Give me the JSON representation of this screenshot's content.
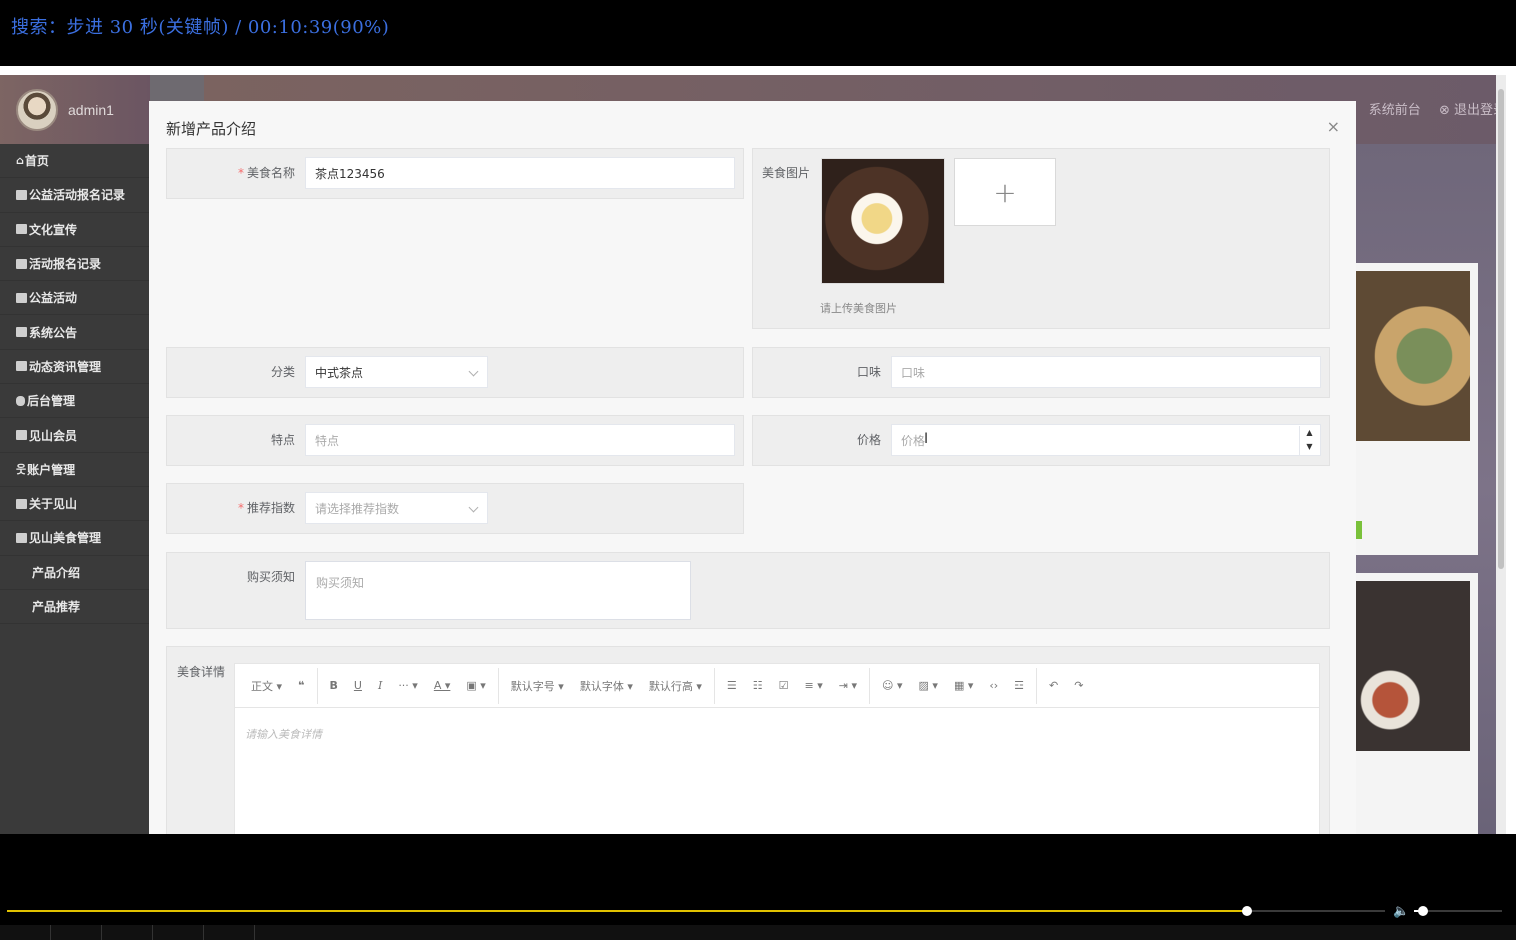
{
  "osd": {
    "text": "搜索：步进 30 秒(关键帧) / 00:10:39(90%)"
  },
  "sidebar": {
    "username": "admin1",
    "items": [
      {
        "label": "首页",
        "icon": "home-icon"
      },
      {
        "label": "公益活动报名记录",
        "icon": "grid-icon"
      },
      {
        "label": "文化宣传",
        "icon": "grid-icon"
      },
      {
        "label": "活动报名记录",
        "icon": "grid-icon"
      },
      {
        "label": "公益活动",
        "icon": "grid-icon"
      },
      {
        "label": "系统公告",
        "icon": "grid-icon"
      },
      {
        "label": "动态资讯管理",
        "icon": "grid-icon"
      },
      {
        "label": "后台管理",
        "icon": "grid-icon"
      },
      {
        "label": "见山会员",
        "icon": "grid-icon"
      },
      {
        "label": "账户管理",
        "icon": "user-icon"
      },
      {
        "label": "关于见山",
        "icon": "briefcase-icon"
      },
      {
        "label": "见山美食管理",
        "icon": "grid-icon"
      }
    ],
    "subitems": [
      "产品介绍",
      "产品推荐"
    ]
  },
  "header": {
    "front_link": "系统前台",
    "logout": "退出登录"
  },
  "modal": {
    "title": "新增产品介绍",
    "close": "×",
    "fields": {
      "name_label": "美食名称",
      "name_value": "茶点123456",
      "image_label": "美食图片",
      "image_hint": "请上传美食图片",
      "upload_plus": "+",
      "category_label": "分类",
      "category_value": "中式茶点",
      "taste_label": "口味",
      "taste_placeholder": "口味",
      "feature_label": "特点",
      "feature_placeholder": "特点",
      "price_label": "价格",
      "price_placeholder": "价格",
      "recommend_label": "推荐指数",
      "recommend_placeholder": "请选择推荐指数",
      "notice_label": "购买须知",
      "notice_placeholder": "购买须知",
      "detail_label": "美食详情",
      "detail_placeholder": "请输入美食详情"
    },
    "toolbar": {
      "paragraph": "正文",
      "font_size": "默认字号",
      "font_family": "默认字体",
      "line_height": "默认行高"
    }
  },
  "player": {
    "progress": 0.9,
    "volume": 0.1
  }
}
